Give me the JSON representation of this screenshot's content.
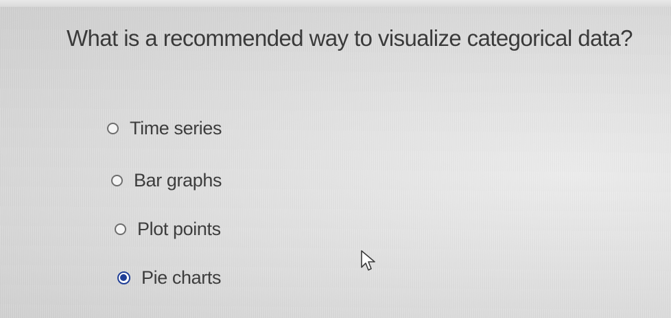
{
  "question": {
    "text": "What is a recommended way to visualize categorical data?"
  },
  "options": [
    {
      "label": "Time series",
      "selected": false
    },
    {
      "label": "Bar graphs",
      "selected": false
    },
    {
      "label": "Plot points",
      "selected": false
    },
    {
      "label": "Pie charts",
      "selected": true
    }
  ],
  "colors": {
    "radio_selected": "#1f3e97",
    "radio_border": "#6d6d6d",
    "text": "#3a3a3a"
  },
  "cursor": {
    "icon": "arrow-cursor-icon"
  }
}
